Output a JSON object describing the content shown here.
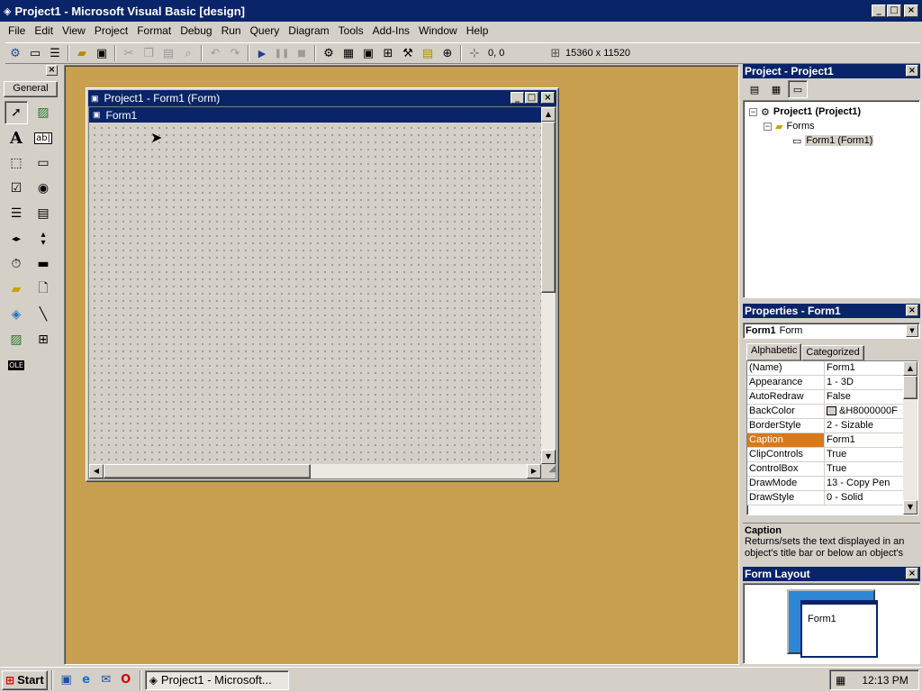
{
  "app": {
    "title": "Project1 - Microsoft Visual Basic [design]",
    "title_icon": "vb-icon",
    "window_controls": [
      "minimize",
      "maximize",
      "close"
    ]
  },
  "menu": {
    "items": [
      "File",
      "Edit",
      "View",
      "Project",
      "Format",
      "Debug",
      "Run",
      "Query",
      "Diagram",
      "Tools",
      "Add-Ins",
      "Window",
      "Help"
    ]
  },
  "toolbar": {
    "position": "0, 0",
    "size": "15360 x 11520",
    "icons": [
      "add-project-icon",
      "add-form-icon",
      "menu-editor-icon",
      "open-icon",
      "save-icon",
      "cut-icon",
      "copy-icon",
      "paste-icon",
      "find-icon",
      "undo-icon",
      "redo-icon",
      "start-icon",
      "break-icon",
      "end-icon",
      "project-explorer-icon",
      "properties-icon",
      "form-layout-icon",
      "object-browser-icon",
      "toolbox-icon",
      "data-view-icon",
      "component-manager-icon"
    ]
  },
  "toolbox": {
    "tab": "General",
    "tools": [
      "pointer",
      "picturebox",
      "label",
      "textbox",
      "frame",
      "commandbutton",
      "checkbox",
      "optionbutton",
      "combobox",
      "listbox",
      "hscrollbar",
      "vscrollbar",
      "timer",
      "drivelistbox",
      "dirlistbox",
      "filelistbox",
      "shape",
      "line",
      "image",
      "data",
      "ole"
    ]
  },
  "form_window": {
    "title": "Project1 - Form1 (Form)",
    "form_caption": "Form1"
  },
  "project_explorer": {
    "title": "Project - Project1",
    "root": "Project1 (Project1)",
    "folder": "Forms",
    "item": "Form1 (Form1)"
  },
  "properties": {
    "title": "Properties - Form1",
    "object_name": "Form1",
    "object_type": "Form",
    "tabs": [
      "Alphabetic",
      "Categorized"
    ],
    "active_tab": "Alphabetic",
    "rows": [
      {
        "name": "(Name)",
        "value": "Form1"
      },
      {
        "name": "Appearance",
        "value": "1 - 3D"
      },
      {
        "name": "AutoRedraw",
        "value": "False"
      },
      {
        "name": "BackColor",
        "value": "&H8000000F"
      },
      {
        "name": "BorderStyle",
        "value": "2 - Sizable"
      },
      {
        "name": "Caption",
        "value": "Form1"
      },
      {
        "name": "ClipControls",
        "value": "True"
      },
      {
        "name": "ControlBox",
        "value": "True"
      },
      {
        "name": "DrawMode",
        "value": "13 - Copy Pen"
      },
      {
        "name": "DrawStyle",
        "value": "0 - Solid"
      }
    ],
    "selected_row": "Caption",
    "desc_title": "Caption",
    "desc_text": "Returns/sets the text displayed in an object's title bar or below an object's"
  },
  "form_layout": {
    "title": "Form Layout",
    "form_label": "Form1"
  },
  "taskbar": {
    "start": "Start",
    "task": "Project1 - Microsoft...",
    "clock": "12:13 PM"
  },
  "colors": {
    "title_active": "#0a246a",
    "mdi_background": "#c9a04f",
    "selection": "#d8791a",
    "face": "#d4d0c8"
  }
}
